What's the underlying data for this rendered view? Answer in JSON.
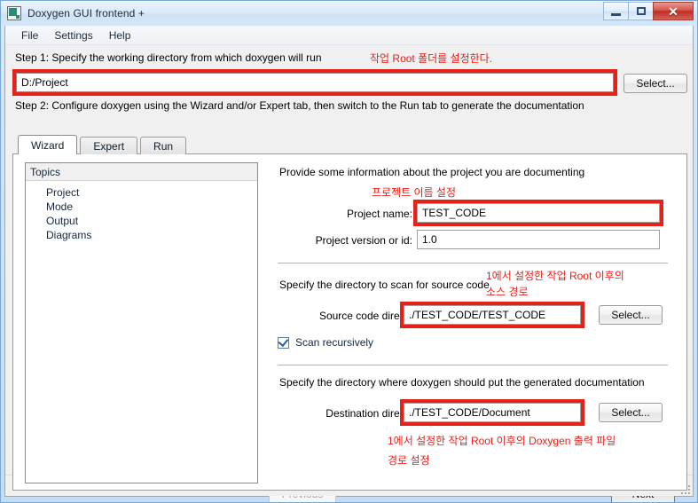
{
  "window": {
    "title": "Doxygen GUI frontend +",
    "icon": "app-icon",
    "minimize_label": "–",
    "maximize_label": "□",
    "close_label": "✕"
  },
  "menubar": {
    "items": [
      {
        "label": "File"
      },
      {
        "label": "Settings"
      },
      {
        "label": "Help"
      }
    ]
  },
  "step1": {
    "label": "Step 1: Specify the working directory from which doxygen will run",
    "annotation": "작업 Root 폴더를 설정한다.",
    "path_value": "D:/Project",
    "path_placeholder": "",
    "select_label": "Select..."
  },
  "step2": {
    "label": "Step 2: Configure doxygen using the Wizard and/or Expert tab, then switch to the Run tab to generate the documentation"
  },
  "tabs": [
    {
      "label": "Wizard",
      "active": true
    },
    {
      "label": "Expert",
      "active": false
    },
    {
      "label": "Run",
      "active": false
    }
  ],
  "topics": {
    "header": "Topics",
    "items": [
      {
        "label": "Project"
      },
      {
        "label": "Mode"
      },
      {
        "label": "Output"
      },
      {
        "label": "Diagrams"
      }
    ]
  },
  "wizard": {
    "project_section_desc": "Provide some information about the project you are documenting",
    "project_name_annotation": "프로젝트 이름 설정",
    "project_name_label": "Project name:",
    "project_name_value": "TEST_CODE",
    "project_version_label": "Project version or id:",
    "project_version_value": "1.0",
    "source_section_desc": "Specify the directory to scan for source code",
    "source_annotation_line1": "1에서 설정한 작업 Root 이후의",
    "source_annotation_line2": "소스 경로",
    "source_dir_label": "Source code directory:",
    "source_dir_value": "./TEST_CODE/TEST_CODE",
    "source_select_label": "Select...",
    "scan_recursively_label": "Scan recursively",
    "scan_recursively_checked": true,
    "dest_section_desc": "Specify the directory where doxygen should put the generated documentation",
    "dest_dir_label": "Destination directory:",
    "dest_dir_value": "./TEST_CODE/Document",
    "dest_select_label": "Select...",
    "dest_annotation_line1": "1에서 설정한 작업 Root 이후의 Doxygen 출력 파일",
    "dest_annotation_line2": "경로 설정"
  },
  "navigation": {
    "previous_label": "Previous",
    "next_label": "Next"
  },
  "colors": {
    "annotation_red": "#e8201a",
    "title_blue": "#cfe3f5",
    "accent_close": "#bf2d22"
  }
}
